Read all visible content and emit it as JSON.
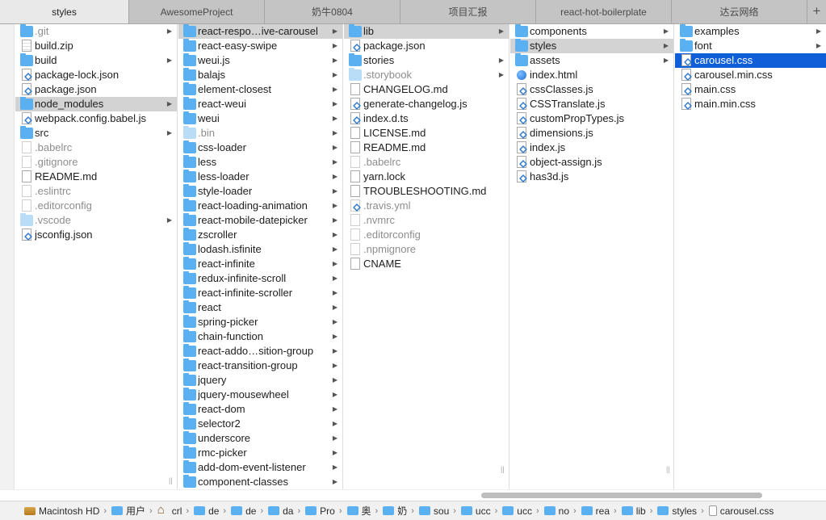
{
  "tabs": [
    {
      "label": "styles",
      "active": true,
      "width": 160
    },
    {
      "label": "AwesomeProject",
      "active": false,
      "width": 168
    },
    {
      "label": "奶牛0804",
      "active": false,
      "width": 168
    },
    {
      "label": "项目汇报",
      "active": false,
      "width": 168
    },
    {
      "label": "react-hot-boilerplate",
      "active": false,
      "width": 168
    },
    {
      "label": "达云网络",
      "active": false,
      "width": 168
    }
  ],
  "tab_add_label": "+",
  "columns": [
    {
      "items": [
        {
          "name": ".git",
          "icon": "folder",
          "dim": true,
          "arrow": true
        },
        {
          "name": "build.zip",
          "icon": "zip"
        },
        {
          "name": "build",
          "icon": "folder",
          "arrow": true
        },
        {
          "name": "package-lock.json",
          "icon": "vs"
        },
        {
          "name": "package.json",
          "icon": "vs"
        },
        {
          "name": "node_modules",
          "icon": "folder",
          "arrow": true,
          "selected": "gray"
        },
        {
          "name": "webpack.config.babel.js",
          "icon": "vs"
        },
        {
          "name": "src",
          "icon": "folder",
          "arrow": true
        },
        {
          "name": ".babelrc",
          "icon": "doc",
          "dim": true
        },
        {
          "name": ".gitignore",
          "icon": "doc",
          "dim": true
        },
        {
          "name": "README.md",
          "icon": "doc"
        },
        {
          "name": ".eslintrc",
          "icon": "doc",
          "dim": true
        },
        {
          "name": ".editorconfig",
          "icon": "doc",
          "dim": true
        },
        {
          "name": ".vscode",
          "icon": "folder-light",
          "dim": true,
          "arrow": true
        },
        {
          "name": "jsconfig.json",
          "icon": "vs"
        }
      ]
    },
    {
      "items": [
        {
          "name": "react-respo…ive-carousel",
          "icon": "folder",
          "arrow": true,
          "selected": "gray"
        },
        {
          "name": "react-easy-swipe",
          "icon": "folder",
          "arrow": true
        },
        {
          "name": "weui.js",
          "icon": "folder",
          "arrow": true
        },
        {
          "name": "balajs",
          "icon": "folder",
          "arrow": true
        },
        {
          "name": "element-closest",
          "icon": "folder",
          "arrow": true
        },
        {
          "name": "react-weui",
          "icon": "folder",
          "arrow": true
        },
        {
          "name": "weui",
          "icon": "folder",
          "arrow": true
        },
        {
          "name": ".bin",
          "icon": "folder-light",
          "dim": true,
          "arrow": true
        },
        {
          "name": "css-loader",
          "icon": "folder",
          "arrow": true
        },
        {
          "name": "less",
          "icon": "folder",
          "arrow": true
        },
        {
          "name": "less-loader",
          "icon": "folder",
          "arrow": true
        },
        {
          "name": "style-loader",
          "icon": "folder",
          "arrow": true
        },
        {
          "name": "react-loading-animation",
          "icon": "folder",
          "arrow": true
        },
        {
          "name": "react-mobile-datepicker",
          "icon": "folder",
          "arrow": true
        },
        {
          "name": "zscroller",
          "icon": "folder",
          "arrow": true
        },
        {
          "name": "lodash.isfinite",
          "icon": "folder",
          "arrow": true
        },
        {
          "name": "react-infinite",
          "icon": "folder",
          "arrow": true
        },
        {
          "name": "redux-infinite-scroll",
          "icon": "folder",
          "arrow": true
        },
        {
          "name": "react-infinite-scroller",
          "icon": "folder",
          "arrow": true
        },
        {
          "name": "react",
          "icon": "folder",
          "arrow": true
        },
        {
          "name": "spring-picker",
          "icon": "folder",
          "arrow": true
        },
        {
          "name": "chain-function",
          "icon": "folder",
          "arrow": true
        },
        {
          "name": "react-addo…sition-group",
          "icon": "folder",
          "arrow": true
        },
        {
          "name": "react-transition-group",
          "icon": "folder",
          "arrow": true
        },
        {
          "name": "jquery",
          "icon": "folder",
          "arrow": true
        },
        {
          "name": "jquery-mousewheel",
          "icon": "folder",
          "arrow": true
        },
        {
          "name": "react-dom",
          "icon": "folder",
          "arrow": true
        },
        {
          "name": "selector2",
          "icon": "folder",
          "arrow": true
        },
        {
          "name": "underscore",
          "icon": "folder",
          "arrow": true
        },
        {
          "name": "rmc-picker",
          "icon": "folder",
          "arrow": true
        },
        {
          "name": "add-dom-event-listener",
          "icon": "folder",
          "arrow": true
        },
        {
          "name": "component-classes",
          "icon": "folder",
          "arrow": true
        }
      ]
    },
    {
      "items": [
        {
          "name": "lib",
          "icon": "folder",
          "arrow": true,
          "selected": "gray"
        },
        {
          "name": "package.json",
          "icon": "vs"
        },
        {
          "name": "stories",
          "icon": "folder",
          "arrow": true
        },
        {
          "name": ".storybook",
          "icon": "folder-light",
          "dim": true,
          "arrow": true
        },
        {
          "name": "CHANGELOG.md",
          "icon": "doc"
        },
        {
          "name": "generate-changelog.js",
          "icon": "vs"
        },
        {
          "name": "index.d.ts",
          "icon": "vs"
        },
        {
          "name": "LICENSE.md",
          "icon": "doc"
        },
        {
          "name": "README.md",
          "icon": "doc"
        },
        {
          "name": ".babelrc",
          "icon": "doc",
          "dim": true
        },
        {
          "name": "yarn.lock",
          "icon": "doc"
        },
        {
          "name": "TROUBLESHOOTING.md",
          "icon": "doc"
        },
        {
          "name": ".travis.yml",
          "icon": "vs-faint",
          "dim": true
        },
        {
          "name": ".nvmrc",
          "icon": "doc",
          "dim": true
        },
        {
          "name": ".editorconfig",
          "icon": "doc",
          "dim": true
        },
        {
          "name": ".npmignore",
          "icon": "doc",
          "dim": true
        },
        {
          "name": "CNAME",
          "icon": "doc"
        }
      ]
    },
    {
      "items": [
        {
          "name": "components",
          "icon": "folder",
          "arrow": true
        },
        {
          "name": "styles",
          "icon": "folder",
          "arrow": true,
          "selected": "gray"
        },
        {
          "name": "assets",
          "icon": "folder",
          "arrow": true
        },
        {
          "name": "index.html",
          "icon": "globe"
        },
        {
          "name": "cssClasses.js",
          "icon": "vs"
        },
        {
          "name": "CSSTranslate.js",
          "icon": "vs"
        },
        {
          "name": "customPropTypes.js",
          "icon": "vs"
        },
        {
          "name": "dimensions.js",
          "icon": "vs"
        },
        {
          "name": "index.js",
          "icon": "vs"
        },
        {
          "name": "object-assign.js",
          "icon": "vs"
        },
        {
          "name": "has3d.js",
          "icon": "vs"
        }
      ]
    },
    {
      "items": [
        {
          "name": "examples",
          "icon": "folder",
          "arrow": true
        },
        {
          "name": "font",
          "icon": "folder",
          "arrow": true
        },
        {
          "name": "carousel.css",
          "icon": "vs",
          "selected": "blue"
        },
        {
          "name": "carousel.min.css",
          "icon": "vs"
        },
        {
          "name": "main.css",
          "icon": "vs"
        },
        {
          "name": "main.min.css",
          "icon": "vs"
        }
      ]
    }
  ],
  "path": [
    {
      "label": "Macintosh HD",
      "icon": "hd"
    },
    {
      "label": "用户",
      "icon": "folder"
    },
    {
      "label": "crl",
      "icon": "home"
    },
    {
      "label": "de",
      "icon": "folder"
    },
    {
      "label": "de",
      "icon": "folder"
    },
    {
      "label": "da",
      "icon": "folder"
    },
    {
      "label": "Pro",
      "icon": "folder"
    },
    {
      "label": "奥",
      "icon": "folder"
    },
    {
      "label": "奶",
      "icon": "folder"
    },
    {
      "label": "sou",
      "icon": "folder"
    },
    {
      "label": "ucc",
      "icon": "folder"
    },
    {
      "label": "ucc",
      "icon": "folder"
    },
    {
      "label": "no",
      "icon": "folder"
    },
    {
      "label": "rea",
      "icon": "folder"
    },
    {
      "label": "lib",
      "icon": "folder"
    },
    {
      "label": "styles",
      "icon": "folder"
    },
    {
      "label": "carousel.css",
      "icon": "file"
    }
  ],
  "colors": {
    "selection_blue": "#0f5fd9",
    "selection_gray": "#d3d3d3",
    "folder_blue": "#5ab0f0"
  }
}
